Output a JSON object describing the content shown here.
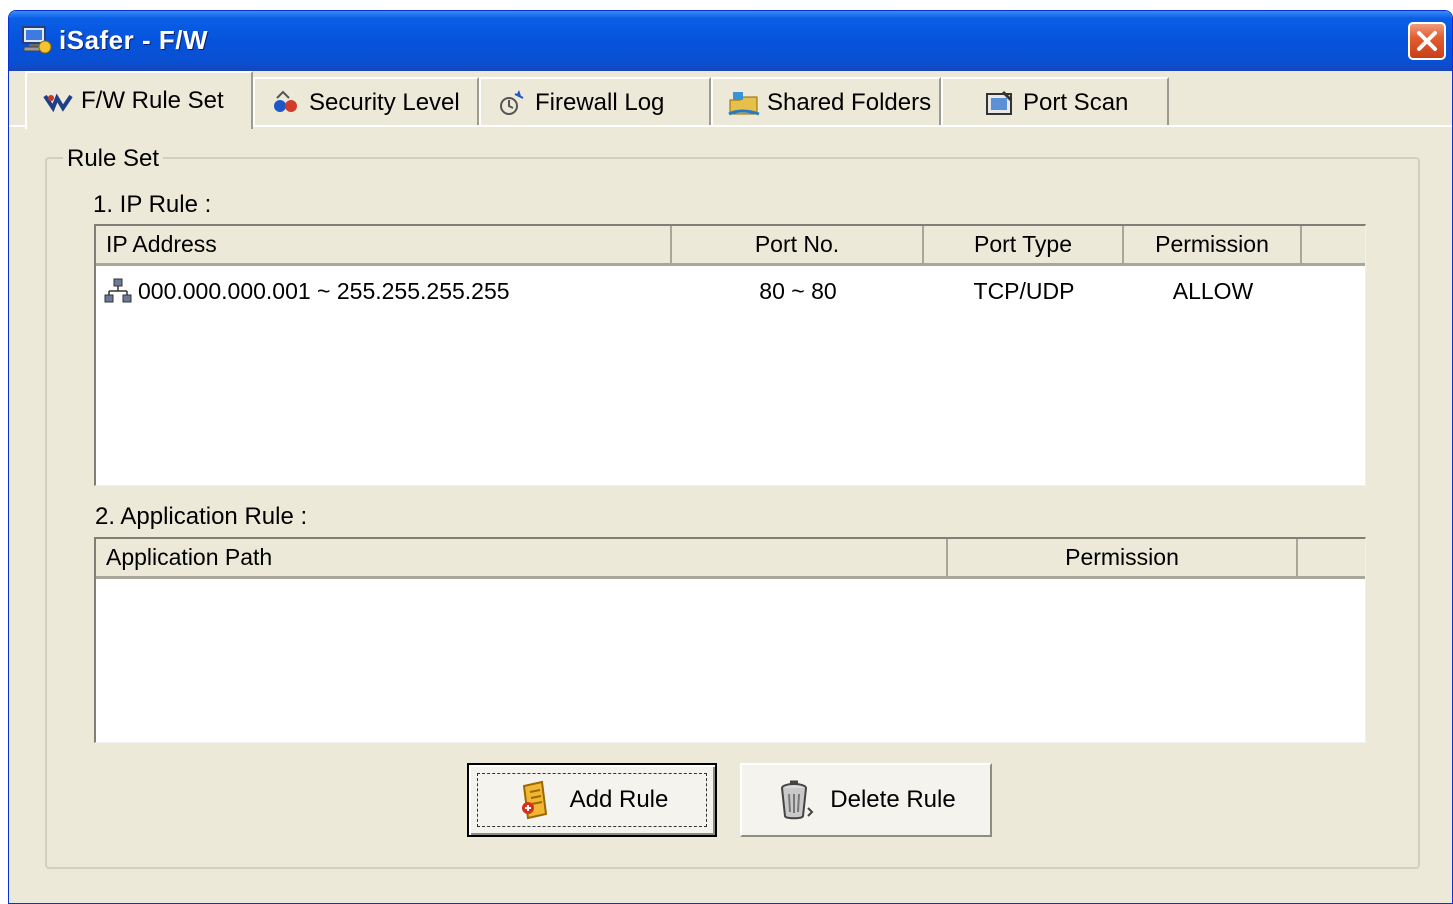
{
  "window": {
    "title": "iSafer - F/W"
  },
  "tabs": [
    {
      "label": "F/W Rule Set",
      "icon": "fw-rule-set-icon",
      "active": true
    },
    {
      "label": "Security Level",
      "icon": "security-level-icon",
      "active": false
    },
    {
      "label": "Firewall Log",
      "icon": "firewall-log-icon",
      "active": false
    },
    {
      "label": "Shared Folders",
      "icon": "shared-folders-icon",
      "active": false
    },
    {
      "label": "Port Scan",
      "icon": "port-scan-icon",
      "active": false
    }
  ],
  "rule_set": {
    "legend": "Rule Set",
    "ip_rule": {
      "label": "1. IP Rule :",
      "columns": [
        "IP Address",
        "Port No.",
        "Port Type",
        "Permission"
      ],
      "rows": [
        {
          "ip_address": "000.000.000.001 ~ 255.255.255.255",
          "port_no": "80 ~ 80",
          "port_type": "TCP/UDP",
          "permission": "ALLOW"
        }
      ]
    },
    "application_rule": {
      "label": "2. Application Rule :",
      "columns": [
        "Application Path",
        "Permission"
      ],
      "rows": []
    }
  },
  "buttons": {
    "add_rule": "Add Rule",
    "delete_rule": "Delete Rule"
  },
  "colors": {
    "titlebar": "#0553dd",
    "window_bg": "#ece9d8",
    "close_button": "#e15d30"
  }
}
